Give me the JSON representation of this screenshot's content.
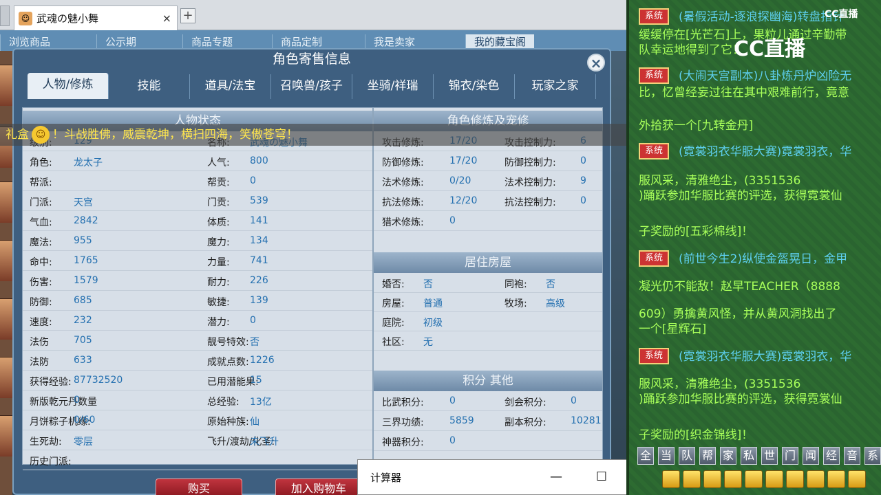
{
  "browser": {
    "tab_title": "武魂の魅小舞",
    "tab_close": "×",
    "new_tab": "+"
  },
  "webnav": {
    "items": [
      "浏览商品",
      "公示期",
      "商品专题",
      "商品定制",
      "我是卖家",
      "我的藏宝阁"
    ]
  },
  "window": {
    "title": "角色寄售信息",
    "close": "×",
    "tabs": [
      "人物/修炼",
      "技能",
      "道具/法宝",
      "召唤兽/孩子",
      "坐骑/祥瑞",
      "锦衣/染色",
      "玩家之家"
    ]
  },
  "status": {
    "header": "人物状态",
    "rows": [
      [
        "级别:",
        "129",
        "名称:",
        "武魂の魅小舞"
      ],
      [
        "角色:",
        "龙太子",
        "人气:",
        "800"
      ],
      [
        "帮派:",
        "",
        "帮贡:",
        "0"
      ],
      [
        "门派:",
        "天宫",
        "门贡:",
        "539"
      ],
      [
        "气血:",
        "2842",
        "体质:",
        "141"
      ],
      [
        "魔法:",
        "955",
        "魔力:",
        "134"
      ],
      [
        "命中:",
        "1765",
        "力量:",
        "741"
      ],
      [
        "伤害:",
        "1579",
        "耐力:",
        "226"
      ],
      [
        "防御:",
        "685",
        "敏捷:",
        "139"
      ],
      [
        "速度:",
        "232",
        "潜力:",
        "0"
      ],
      [
        "法伤",
        "705",
        "靓号特效:",
        "否"
      ],
      [
        "法防",
        "633",
        "成就点数:",
        "1226"
      ],
      [
        "获得经验:",
        "87732520",
        "已用潜能果:",
        "15"
      ],
      [
        "新版乾元丹数量",
        "0",
        "总经验:",
        "13亿"
      ],
      [
        "月饼粽子机缘:",
        "0/60",
        "原始种族:",
        "仙"
      ],
      [
        "生死劫:",
        "零层",
        "飞升/渡劫/化圣:",
        "未飞升"
      ],
      [
        "历史门派:",
        "",
        "",
        ""
      ]
    ]
  },
  "cultivation": {
    "header": "角色修炼及宠修",
    "rows": [
      [
        "攻击修炼:",
        "17/20",
        "攻击控制力:",
        "6"
      ],
      [
        "防御修炼:",
        "17/20",
        "防御控制力:",
        "0"
      ],
      [
        "法术修炼:",
        "0/20",
        "法术控制力:",
        "9"
      ],
      [
        "抗法修炼:",
        "12/20",
        "抗法控制力:",
        "0"
      ],
      [
        "猎术修炼:",
        "0",
        "",
        ""
      ]
    ]
  },
  "housing": {
    "header": "居住房屋",
    "rows": [
      [
        "婚否:",
        "否",
        "同袍:",
        "否"
      ],
      [
        "房屋:",
        "普通",
        "牧场:",
        "高级"
      ],
      [
        "庭院:",
        "初级",
        "",
        ""
      ],
      [
        "社区:",
        "无",
        "",
        ""
      ]
    ]
  },
  "points": {
    "header": "积分 其他",
    "rows": [
      [
        "比武积分:",
        "0",
        "剑会积分:",
        "0"
      ],
      [
        "三界功绩:",
        "5859",
        "副本积分:",
        "10281"
      ],
      [
        "神器积分:",
        "0",
        "",
        ""
      ]
    ]
  },
  "banner": {
    "prefix": "礼盒",
    "text": "！斗战胜佛，威震乾坤，横扫四海，笑傲苍穹！"
  },
  "buttons": {
    "buy": "购买",
    "cart": "加入购物车"
  },
  "calculator": {
    "title": "计算器",
    "min": "—",
    "max": "☐",
    "close": "✕"
  },
  "chat": {
    "logo": "CC直播",
    "logo_small": "CC直播",
    "tag": "系统",
    "lines": [
      {
        "t": "tag",
        "text": "系统"
      },
      {
        "c": "cy",
        "text": "(暑假活动-逐浪探幽海)转盘指针"
      },
      {
        "c": "cg",
        "text": "缓缓停在[光芒石]上，果粒儿通过辛勤带"
      },
      {
        "c": "cg",
        "text": "队幸运地得到了它！"
      },
      {
        "c": "cy",
        "text": "(大闹天宫副本)八卦炼丹炉凶险无"
      },
      {
        "c": "cg",
        "text": "比，忆曾经妄过往在其中艰难前行，竟意"
      },
      {
        "c": "cg",
        "text": "外拾获一个[九转金丹]"
      },
      {
        "c": "cy",
        "text": "(霓裳羽衣华服大赛)霓裳羽衣，华"
      },
      {
        "c": "cg",
        "text": "服风采，清雅绝尘，(3351536"
      },
      {
        "c": "cg",
        "text": ")踊跃参加华服比赛的评选，获得霓裳仙"
      },
      {
        "c": "cg",
        "text": "子奖励的[五彩棉线]！"
      },
      {
        "c": "cy",
        "text": "(前世今生2)纵使金盔晃日，金甲"
      },
      {
        "c": "cg",
        "text": "凝光仍不能敌！赵早TEACHER（8888"
      },
      {
        "c": "cg",
        "text": "609）勇擒黄风怪，并从黄风洞找出了"
      },
      {
        "c": "cg",
        "text": "一个[星辉石]"
      },
      {
        "c": "cy",
        "text": "(霓裳羽衣华服大赛)霓裳羽衣，华"
      },
      {
        "c": "cg",
        "text": "服风采，清雅绝尘，(3351536"
      },
      {
        "c": "cg",
        "text": ")踊跃参加华服比赛的评选，获得霓裳仙"
      },
      {
        "c": "cg",
        "text": "子奖励的[织金锦线]！"
      }
    ],
    "channels": [
      "全",
      "当",
      "队",
      "帮",
      "家",
      "私",
      "世",
      "门",
      "闻",
      "经",
      "音",
      "系"
    ]
  }
}
